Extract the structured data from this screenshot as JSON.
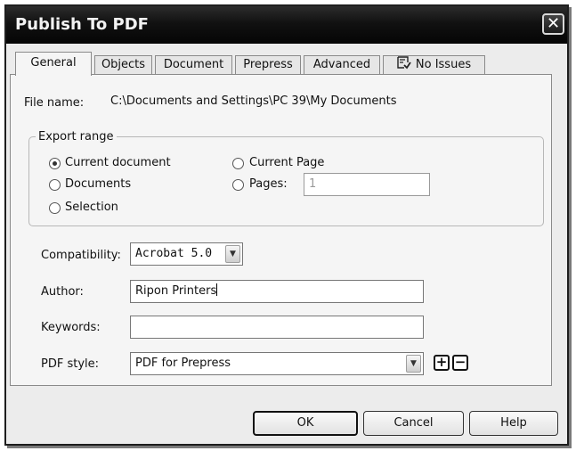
{
  "window": {
    "title": "Publish To PDF",
    "close_icon": "close-icon",
    "close_glyph": "✕"
  },
  "tabs": [
    {
      "label": "General",
      "active": true
    },
    {
      "label": "Objects",
      "active": false
    },
    {
      "label": "Document",
      "active": false
    },
    {
      "label": "Prepress",
      "active": false
    },
    {
      "label": "Advanced",
      "active": false
    },
    {
      "label": "No Issues",
      "active": false,
      "icon": "checklist-icon"
    }
  ],
  "general": {
    "file_name_label": "File name:",
    "file_name_value": "C:\\Documents and Settings\\PC 39\\My Documents",
    "export_range": {
      "legend": "Export range",
      "options": [
        {
          "label": "Current document",
          "checked": true
        },
        {
          "label": "Documents",
          "checked": false
        },
        {
          "label": "Selection",
          "checked": false
        },
        {
          "label": "Current Page",
          "checked": false
        },
        {
          "label": "Pages:",
          "checked": false
        }
      ],
      "pages_value": "1"
    },
    "compatibility_label": "Compatibility:",
    "compatibility_value": "Acrobat 5.0",
    "author_label": "Author:",
    "author_value": "Ripon Printers",
    "keywords_label": "Keywords:",
    "keywords_value": "",
    "pdf_style_label": "PDF style:",
    "pdf_style_value": "PDF for Prepress",
    "add_glyph": "+",
    "remove_glyph": "−"
  },
  "buttons": {
    "ok": "OK",
    "cancel": "Cancel",
    "help": "Help"
  },
  "colors": {
    "titlebar": "#0c0c0c",
    "dialog_bg": "#ececec",
    "panel_bg": "#f5f5f5"
  }
}
